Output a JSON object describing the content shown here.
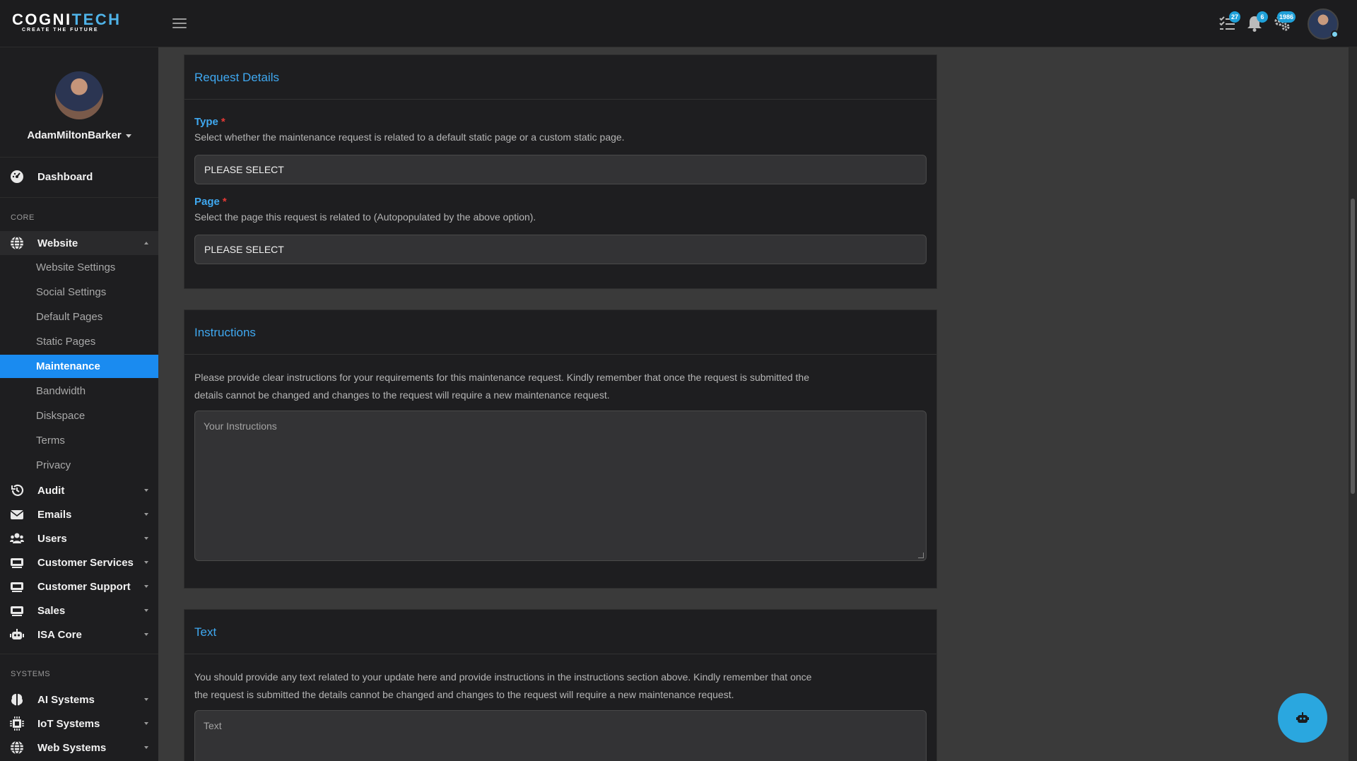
{
  "brand": {
    "name_part1": "COGNI",
    "name_part2": "TECH",
    "tagline": "CREATE THE FUTURE"
  },
  "topbar": {
    "tasks_badge": "27",
    "notifications_badge": "6",
    "settings_badge": "1986"
  },
  "profile": {
    "username": "AdamMiltonBarker"
  },
  "sidebar": {
    "dashboard": "Dashboard",
    "core_label": "CORE",
    "website": "Website",
    "website_children": [
      "Website Settings",
      "Social Settings",
      "Default Pages",
      "Static Pages",
      "Maintenance",
      "Bandwidth",
      "Diskspace",
      "Terms",
      "Privacy"
    ],
    "audit": "Audit",
    "emails": "Emails",
    "users": "Users",
    "customer_services": "Customer Services",
    "customer_support": "Customer Support",
    "sales": "Sales",
    "isa_core": "ISA Core",
    "systems_label": "SYSTEMS",
    "ai_systems": "AI Systems",
    "iot_systems": "IoT Systems",
    "web_systems": "Web Systems"
  },
  "request_details": {
    "title": "Request Details",
    "type_label": "Type",
    "required_mark": "*",
    "type_help": "Select whether the maintenance request is related to a default static page or a custom static page.",
    "type_value": "PLEASE SELECT",
    "page_label": "Page",
    "page_help": "Select the page this request is related to (Autopopulated by the above option).",
    "page_value": "PLEASE SELECT"
  },
  "instructions": {
    "title": "Instructions",
    "help_line1": "Please provide clear instructions for your requirements for this maintenance request. Kindly remember that once the request is submitted the",
    "help_line2": "details cannot be changed and changes to the request will require a new maintenance request.",
    "placeholder": "Your Instructions"
  },
  "text_section": {
    "title": "Text",
    "help_line1": "You should provide any text related to your update here and provide instructions in the instructions section above. Kindly remember that once",
    "help_line2": "the request is submitted the details cannot be changed and changes to the request will require a new maintenance request.",
    "placeholder": "Text"
  },
  "colors": {
    "accent": "#3fa8f0",
    "active_nav": "#1a8bf0",
    "fab": "#2aa7df",
    "required": "#e53935"
  }
}
